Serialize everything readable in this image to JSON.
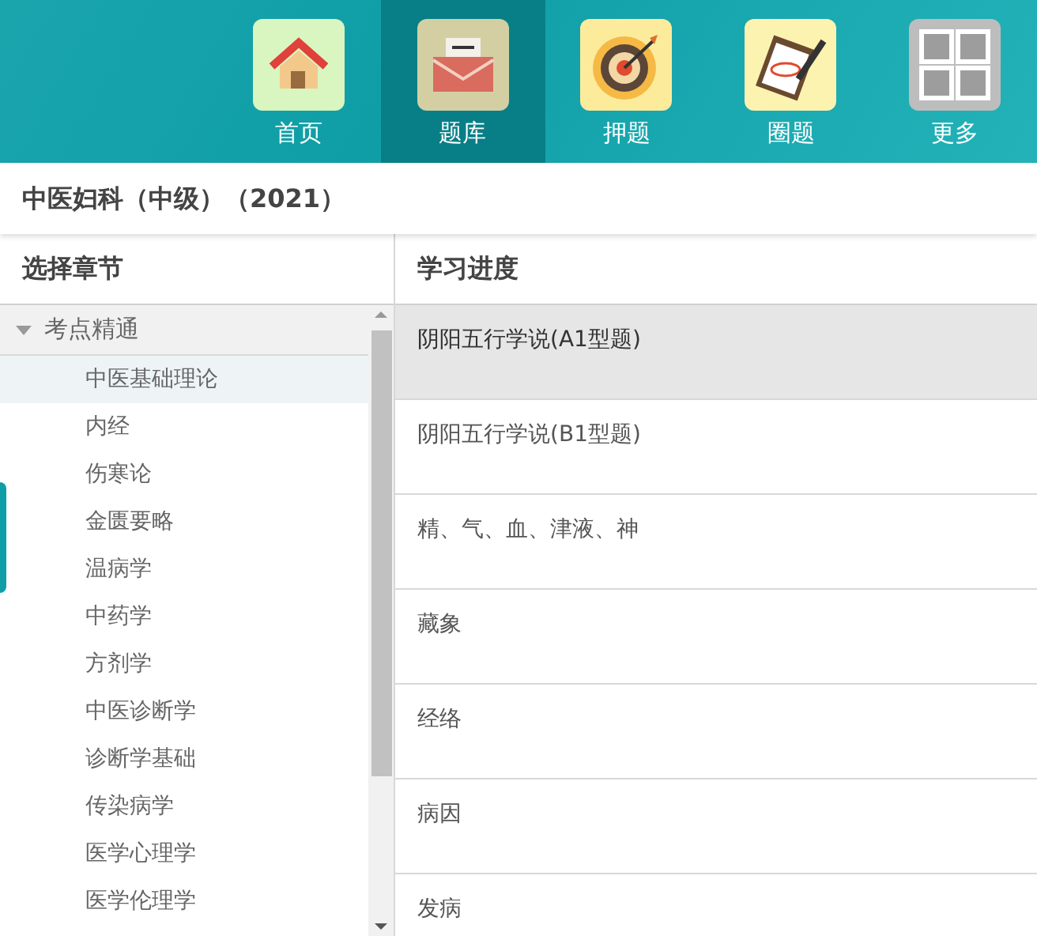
{
  "nav": [
    {
      "label": "首页",
      "kind": "home",
      "selected": false
    },
    {
      "label": "题库",
      "kind": "bank",
      "selected": true
    },
    {
      "label": "押题",
      "kind": "target",
      "selected": false
    },
    {
      "label": "圈题",
      "kind": "clipboard",
      "selected": false
    },
    {
      "label": "更多",
      "kind": "more",
      "selected": false
    }
  ],
  "course_title": "中医妇科（中级）（2021）",
  "chapters": {
    "heading": "选择章节",
    "tree": [
      {
        "label": "考点精通",
        "expanded": true,
        "children": [
          {
            "label": "中医基础理论",
            "selected": true
          },
          {
            "label": "内经",
            "selected": false
          },
          {
            "label": "伤寒论",
            "selected": false
          },
          {
            "label": "金匮要略",
            "selected": false
          },
          {
            "label": "温病学",
            "selected": false
          },
          {
            "label": "中药学",
            "selected": false
          },
          {
            "label": "方剂学",
            "selected": false
          },
          {
            "label": "中医诊断学",
            "selected": false
          },
          {
            "label": "诊断学基础",
            "selected": false
          },
          {
            "label": "传染病学",
            "selected": false
          },
          {
            "label": "医学心理学",
            "selected": false
          },
          {
            "label": "医学伦理学",
            "selected": false
          }
        ]
      }
    ]
  },
  "progress": {
    "heading": "学习进度",
    "rows": [
      {
        "label": "阴阳五行学说(A1型题)",
        "selected": true
      },
      {
        "label": "阴阳五行学说(B1型题)",
        "selected": false
      },
      {
        "label": "精、气、血、津液、神",
        "selected": false
      },
      {
        "label": "藏象",
        "selected": false
      },
      {
        "label": "经络",
        "selected": false
      },
      {
        "label": "病因",
        "selected": false
      },
      {
        "label": "发病",
        "selected": false
      }
    ]
  }
}
